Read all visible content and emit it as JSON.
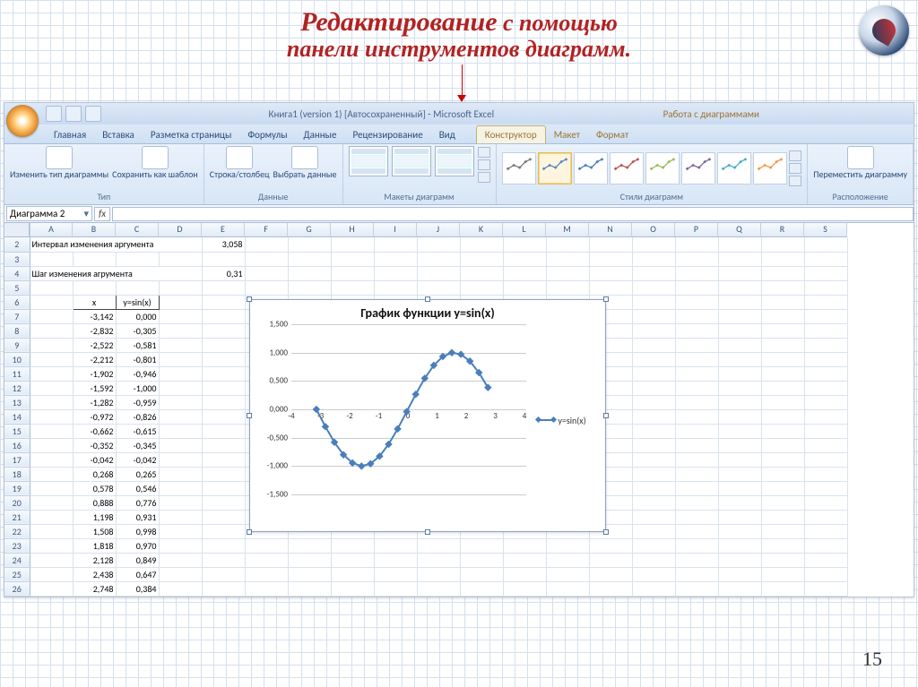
{
  "slide": {
    "title_line1": "Редактирование",
    "title_line2": "с помощью",
    "title_line3": "панели инструментов диаграмм.",
    "page_number": "15"
  },
  "window": {
    "title": "Книга1 (version 1) [Автосохраненный] - Microsoft Excel",
    "context_title": "Работа с диаграммами"
  },
  "tabs": {
    "home": "Главная",
    "insert": "Вставка",
    "layout": "Разметка страницы",
    "formulas": "Формулы",
    "data": "Данные",
    "review": "Рецензирование",
    "view": "Вид",
    "design": "Конструктор",
    "ctx_layout": "Макет",
    "format": "Формат"
  },
  "ribbon": {
    "change_type": "Изменить тип диаграммы",
    "save_template": "Сохранить как шаблон",
    "group_type": "Тип",
    "switch_rc": "Строка/столбец",
    "select_data": "Выбрать данные",
    "group_data": "Данные",
    "group_layouts": "Макеты диаграмм",
    "group_styles": "Стили диаграмм",
    "move_chart": "Переместить диаграмму",
    "group_location": "Расположение"
  },
  "style_colors": [
    "#7a7a7a",
    "#5b87bf",
    "#4a7ebb",
    "#c0504d",
    "#9bbb59",
    "#8064a2",
    "#4bacc6",
    "#f79646"
  ],
  "namebox": "Диаграмма 2",
  "columns": [
    "A",
    "B",
    "C",
    "D",
    "E",
    "F",
    "G",
    "H",
    "I",
    "J",
    "K",
    "L",
    "M",
    "N",
    "O",
    "P",
    "Q",
    "R",
    "S"
  ],
  "rows": [
    "2",
    "3",
    "4",
    "5",
    "6",
    "7",
    "8",
    "9",
    "10",
    "11",
    "12",
    "13",
    "14",
    "15",
    "16",
    "17",
    "18",
    "19",
    "20",
    "21",
    "22",
    "23",
    "24",
    "25",
    "26"
  ],
  "cells": {
    "r2_A": "Интервал изменения аргумента",
    "r2_E": "3,058",
    "r4_A": "Шаг изменения агрумента",
    "r4_E": "0,31",
    "r6_B": "x",
    "r6_C": "y=sin(x)"
  },
  "table": [
    {
      "x": "-3,142",
      "y": "0,000"
    },
    {
      "x": "-2,832",
      "y": "-0,305"
    },
    {
      "x": "-2,522",
      "y": "-0,581"
    },
    {
      "x": "-2,212",
      "y": "-0,801"
    },
    {
      "x": "-1,902",
      "y": "-0,946"
    },
    {
      "x": "-1,592",
      "y": "-1,000"
    },
    {
      "x": "-1,282",
      "y": "-0,959"
    },
    {
      "x": "-0,972",
      "y": "-0,826"
    },
    {
      "x": "-0,662",
      "y": "-0,615"
    },
    {
      "x": "-0,352",
      "y": "-0,345"
    },
    {
      "x": "-0,042",
      "y": "-0,042"
    },
    {
      "x": "0,268",
      "y": "0,265"
    },
    {
      "x": "0,578",
      "y": "0,546"
    },
    {
      "x": "0,888",
      "y": "0,776"
    },
    {
      "x": "1,198",
      "y": "0,931"
    },
    {
      "x": "1,508",
      "y": "0,998"
    },
    {
      "x": "1,818",
      "y": "0,970"
    },
    {
      "x": "2,128",
      "y": "0,849"
    },
    {
      "x": "2,438",
      "y": "0,647"
    },
    {
      "x": "2,748",
      "y": "0,384"
    }
  ],
  "chart_data": {
    "type": "line",
    "title": "График функции y=sin(x)",
    "xlabel": "",
    "ylabel": "",
    "x_ticks": [
      "-4",
      "-3",
      "-2",
      "-1",
      "0",
      "1",
      "2",
      "3",
      "4"
    ],
    "y_ticks": [
      "1,500",
      "1,000",
      "0,500",
      "0,000",
      "-0,500",
      "-1,000",
      "-1,500"
    ],
    "xlim": [
      -4,
      4
    ],
    "ylim": [
      -1.5,
      1.5
    ],
    "series": [
      {
        "name": "y=sin(x)",
        "x": [
          -3.142,
          -2.832,
          -2.522,
          -2.212,
          -1.902,
          -1.592,
          -1.282,
          -0.972,
          -0.662,
          -0.352,
          -0.042,
          0.268,
          0.578,
          0.888,
          1.198,
          1.508,
          1.818,
          2.128,
          2.438,
          2.748
        ],
        "y": [
          0.0,
          -0.305,
          -0.581,
          -0.801,
          -0.946,
          -1.0,
          -0.959,
          -0.826,
          -0.615,
          -0.345,
          -0.042,
          0.265,
          0.546,
          0.776,
          0.931,
          0.998,
          0.97,
          0.849,
          0.647,
          0.384
        ]
      }
    ],
    "legend": "y=sin(x)"
  }
}
